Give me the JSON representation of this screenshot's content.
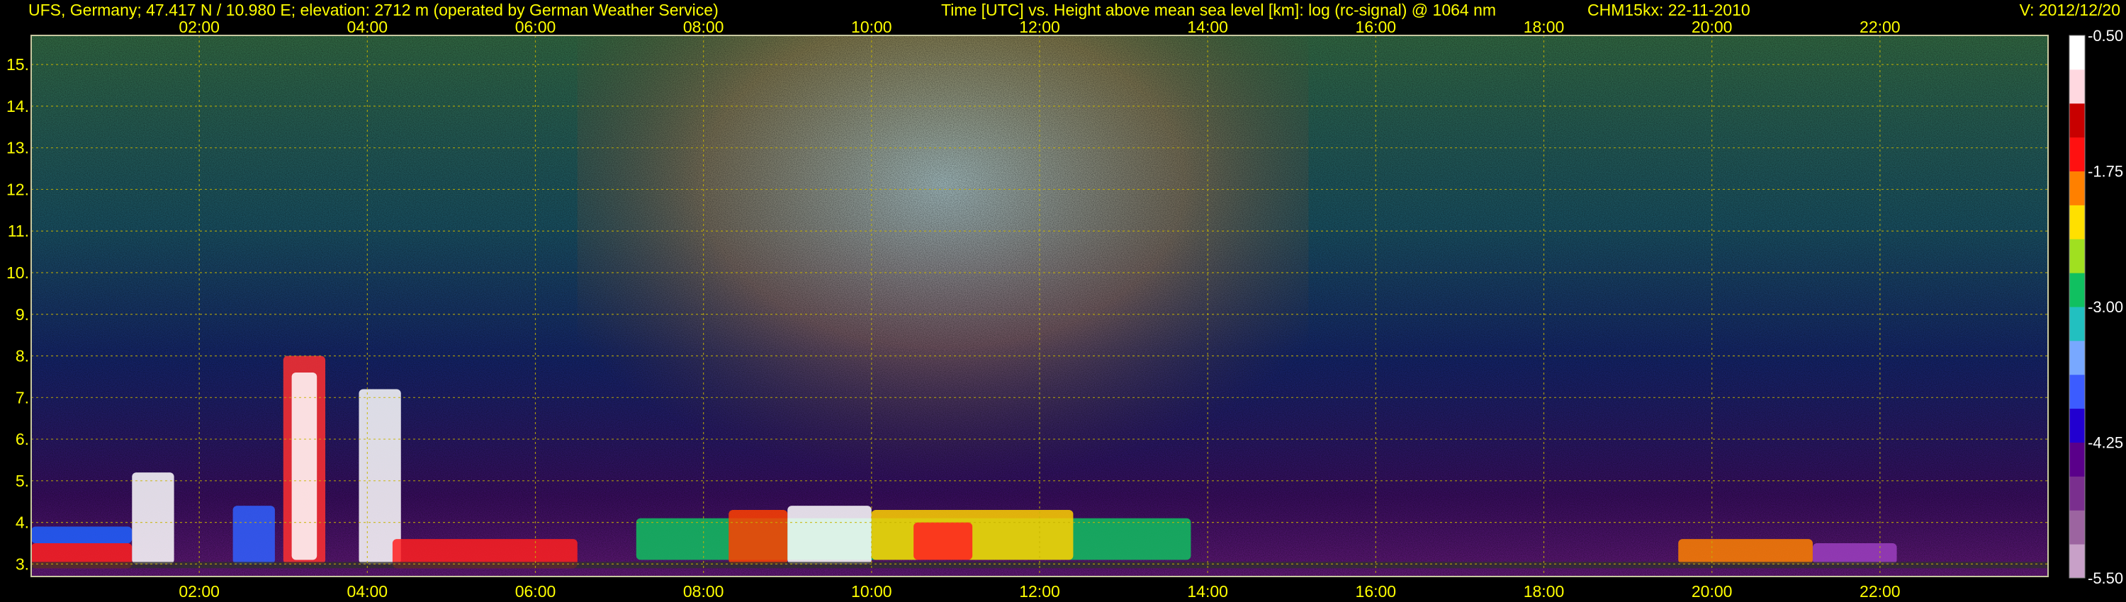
{
  "header": {
    "site": "UFS, Germany; 47.417 N / 10.980 E; elevation: 2712 m  (operated by German Weather Service)",
    "description": "Time [UTC] vs. Height above mean sea level [km]: log (rc-signal) @ 1064 nm",
    "instrument": "CHM15kx: 22-11-2010",
    "version": "V: 2012/12/20"
  },
  "colors": {
    "text": "#ffff00",
    "grid": "#c8b400",
    "background": "#000000",
    "frame": "#c8c8a0"
  },
  "chart_data": {
    "type": "heatmap",
    "title": "Time [UTC] vs. Height above mean sea level [km]: log (rc-signal) @ 1064 nm",
    "xlabel": "Time [UTC]",
    "ylabel": "Height above mean sea level [km]",
    "xlim": [
      0,
      24
    ],
    "ylim": [
      2.7,
      15.7
    ],
    "grid": true,
    "x_ticks": [
      {
        "value": 2,
        "label": "02:00"
      },
      {
        "value": 4,
        "label": "04:00"
      },
      {
        "value": 6,
        "label": "06:00"
      },
      {
        "value": 8,
        "label": "08:00"
      },
      {
        "value": 10,
        "label": "10:00"
      },
      {
        "value": 12,
        "label": "12:00"
      },
      {
        "value": 14,
        "label": "14:00"
      },
      {
        "value": 16,
        "label": "16:00"
      },
      {
        "value": 18,
        "label": "18:00"
      },
      {
        "value": 20,
        "label": "20:00"
      },
      {
        "value": 22,
        "label": "22:00"
      }
    ],
    "y_ticks": [
      {
        "value": 3,
        "label": "3."
      },
      {
        "value": 4,
        "label": "4."
      },
      {
        "value": 5,
        "label": "5."
      },
      {
        "value": 6,
        "label": "6."
      },
      {
        "value": 7,
        "label": "7."
      },
      {
        "value": 8,
        "label": "8."
      },
      {
        "value": 9,
        "label": "9."
      },
      {
        "value": 10,
        "label": "10."
      },
      {
        "value": 11,
        "label": "11."
      },
      {
        "value": 12,
        "label": "12."
      },
      {
        "value": 13,
        "label": "13."
      },
      {
        "value": 14,
        "label": "14."
      },
      {
        "value": 15,
        "label": "15."
      }
    ],
    "colorbar": {
      "min": -5.5,
      "max": -0.5,
      "ticks": [
        {
          "value": -0.5,
          "label": "-0.50"
        },
        {
          "value": -1.75,
          "label": "-1.75"
        },
        {
          "value": -3.0,
          "label": "-3.00"
        },
        {
          "value": -4.25,
          "label": "-4.25"
        },
        {
          "value": -5.5,
          "label": "-5.50"
        }
      ],
      "colors": [
        "#c8a0c8",
        "#9c64a0",
        "#7a2f8e",
        "#5a008a",
        "#2200d0",
        "#3c5cff",
        "#78a8ff",
        "#22c0c0",
        "#10c060",
        "#a0e020",
        "#ffe000",
        "#ff8000",
        "#ff1010",
        "#c80000",
        "#ffd8e0",
        "#ffffff"
      ]
    }
  }
}
